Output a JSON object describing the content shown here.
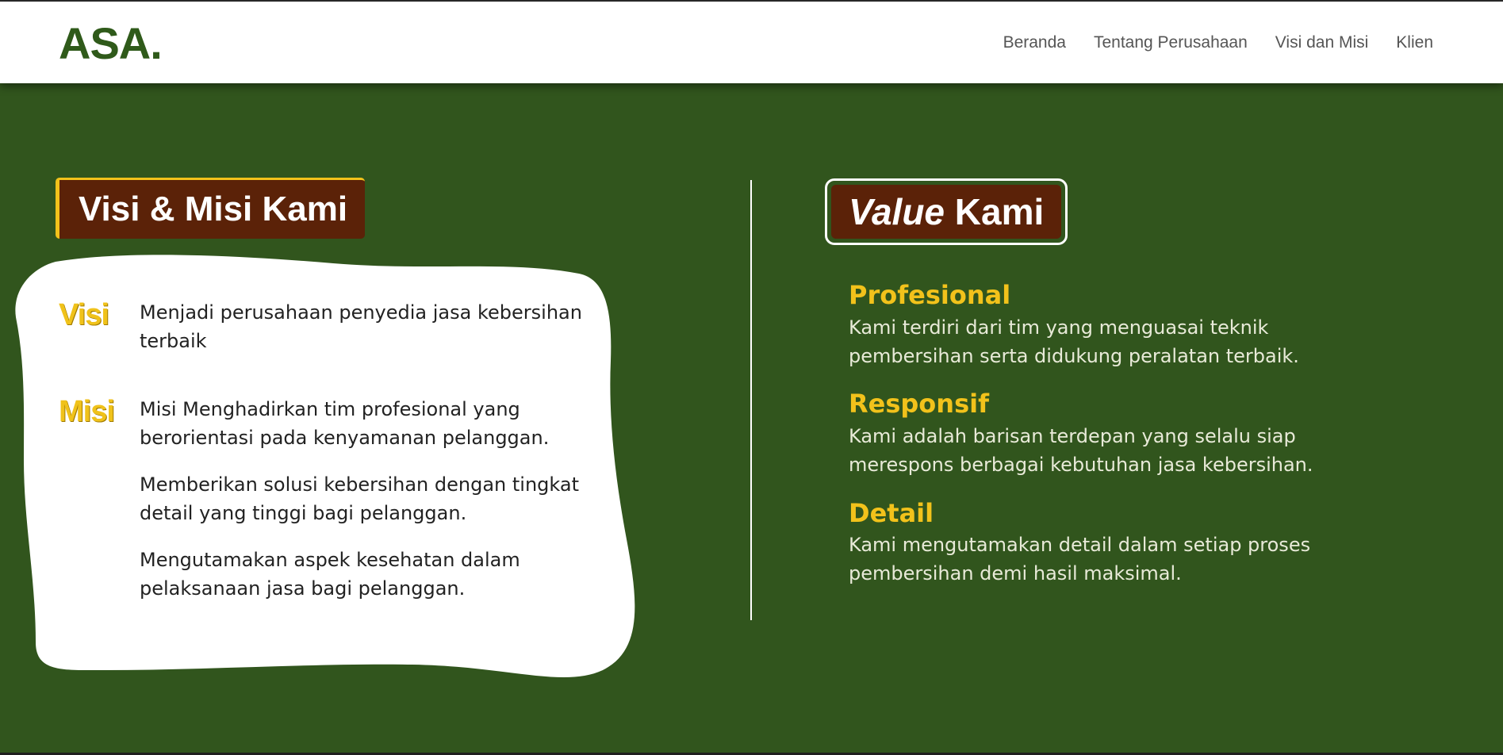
{
  "brand": {
    "logo": "ASA.",
    "color": "#2f5a1a"
  },
  "nav": {
    "items": [
      "Beranda",
      "Tentang Perusahaan",
      "Visi dan Misi",
      "Klien"
    ]
  },
  "colors": {
    "background": "#31551d",
    "badge": "#5b2208",
    "accent": "#f2c21b"
  },
  "visi_misi": {
    "heading": "Visi & Misi Kami",
    "visi_label": "Visi",
    "visi_text": "Menjadi perusahaan penyedia jasa kebersihan terbaik",
    "misi_label": "Misi",
    "misi_items": [
      "Misi Menghadirkan tim profesional yang berorientasi pada kenyamanan pelanggan.",
      "Memberikan solusi kebersihan dengan tingkat detail yang tinggi bagi pelanggan.",
      "Mengutamakan aspek kesehatan dalam pelaksanaan jasa bagi pelanggan."
    ]
  },
  "values": {
    "heading_italic": "Value",
    "heading_rest": " Kami",
    "items": [
      {
        "title": "Profesional",
        "desc": "Kami terdiri dari tim yang menguasai teknik pembersihan serta didukung peralatan terbaik."
      },
      {
        "title": "Responsif",
        "desc": "Kami adalah barisan terdepan yang selalu siap merespons berbagai kebutuhan jasa kebersihan."
      },
      {
        "title": "Detail",
        "desc": "Kami mengutamakan detail dalam setiap proses pembersihan demi hasil maksimal."
      }
    ]
  }
}
